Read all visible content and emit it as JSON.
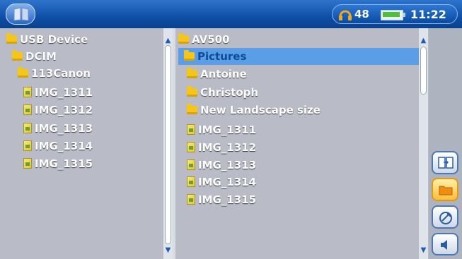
{
  "status": {
    "volume": "48",
    "time": "11:22"
  },
  "left_panel": {
    "items": [
      {
        "label": "USB Device",
        "type": "folder"
      },
      {
        "label": "DCIM",
        "type": "folder"
      },
      {
        "label": "113Canon",
        "type": "folder"
      },
      {
        "label": "IMG_1311",
        "type": "file"
      },
      {
        "label": "IMG_1312",
        "type": "file"
      },
      {
        "label": "IMG_1313",
        "type": "file"
      },
      {
        "label": "IMG_1314",
        "type": "file"
      },
      {
        "label": "IMG_1315",
        "type": "file"
      }
    ]
  },
  "right_panel": {
    "items": [
      {
        "label": "AV500",
        "type": "folder"
      },
      {
        "label": "Pictures",
        "type": "folder",
        "selected": true
      },
      {
        "label": "Antoine",
        "type": "folder"
      },
      {
        "label": "Christoph",
        "type": "folder"
      },
      {
        "label": "New Landscape size",
        "type": "folder"
      },
      {
        "label": "IMG_1311",
        "type": "file"
      },
      {
        "label": "IMG_1312",
        "type": "file"
      },
      {
        "label": "IMG_1313",
        "type": "file"
      },
      {
        "label": "IMG_1314",
        "type": "file"
      },
      {
        "label": "IMG_1315",
        "type": "file"
      }
    ]
  },
  "icons": {
    "home": "home-book-icon",
    "volume": "headphones-icon",
    "battery": "battery-icon",
    "side_buttons": [
      "copy-panels-icon",
      "folder-icon",
      "settings-icon",
      "speaker-icon"
    ]
  },
  "colors": {
    "topbar": "#0e4fa7",
    "selection": "#5c9ee6",
    "panel": "#b9bcc6",
    "active_button": "#ffbe3c"
  }
}
